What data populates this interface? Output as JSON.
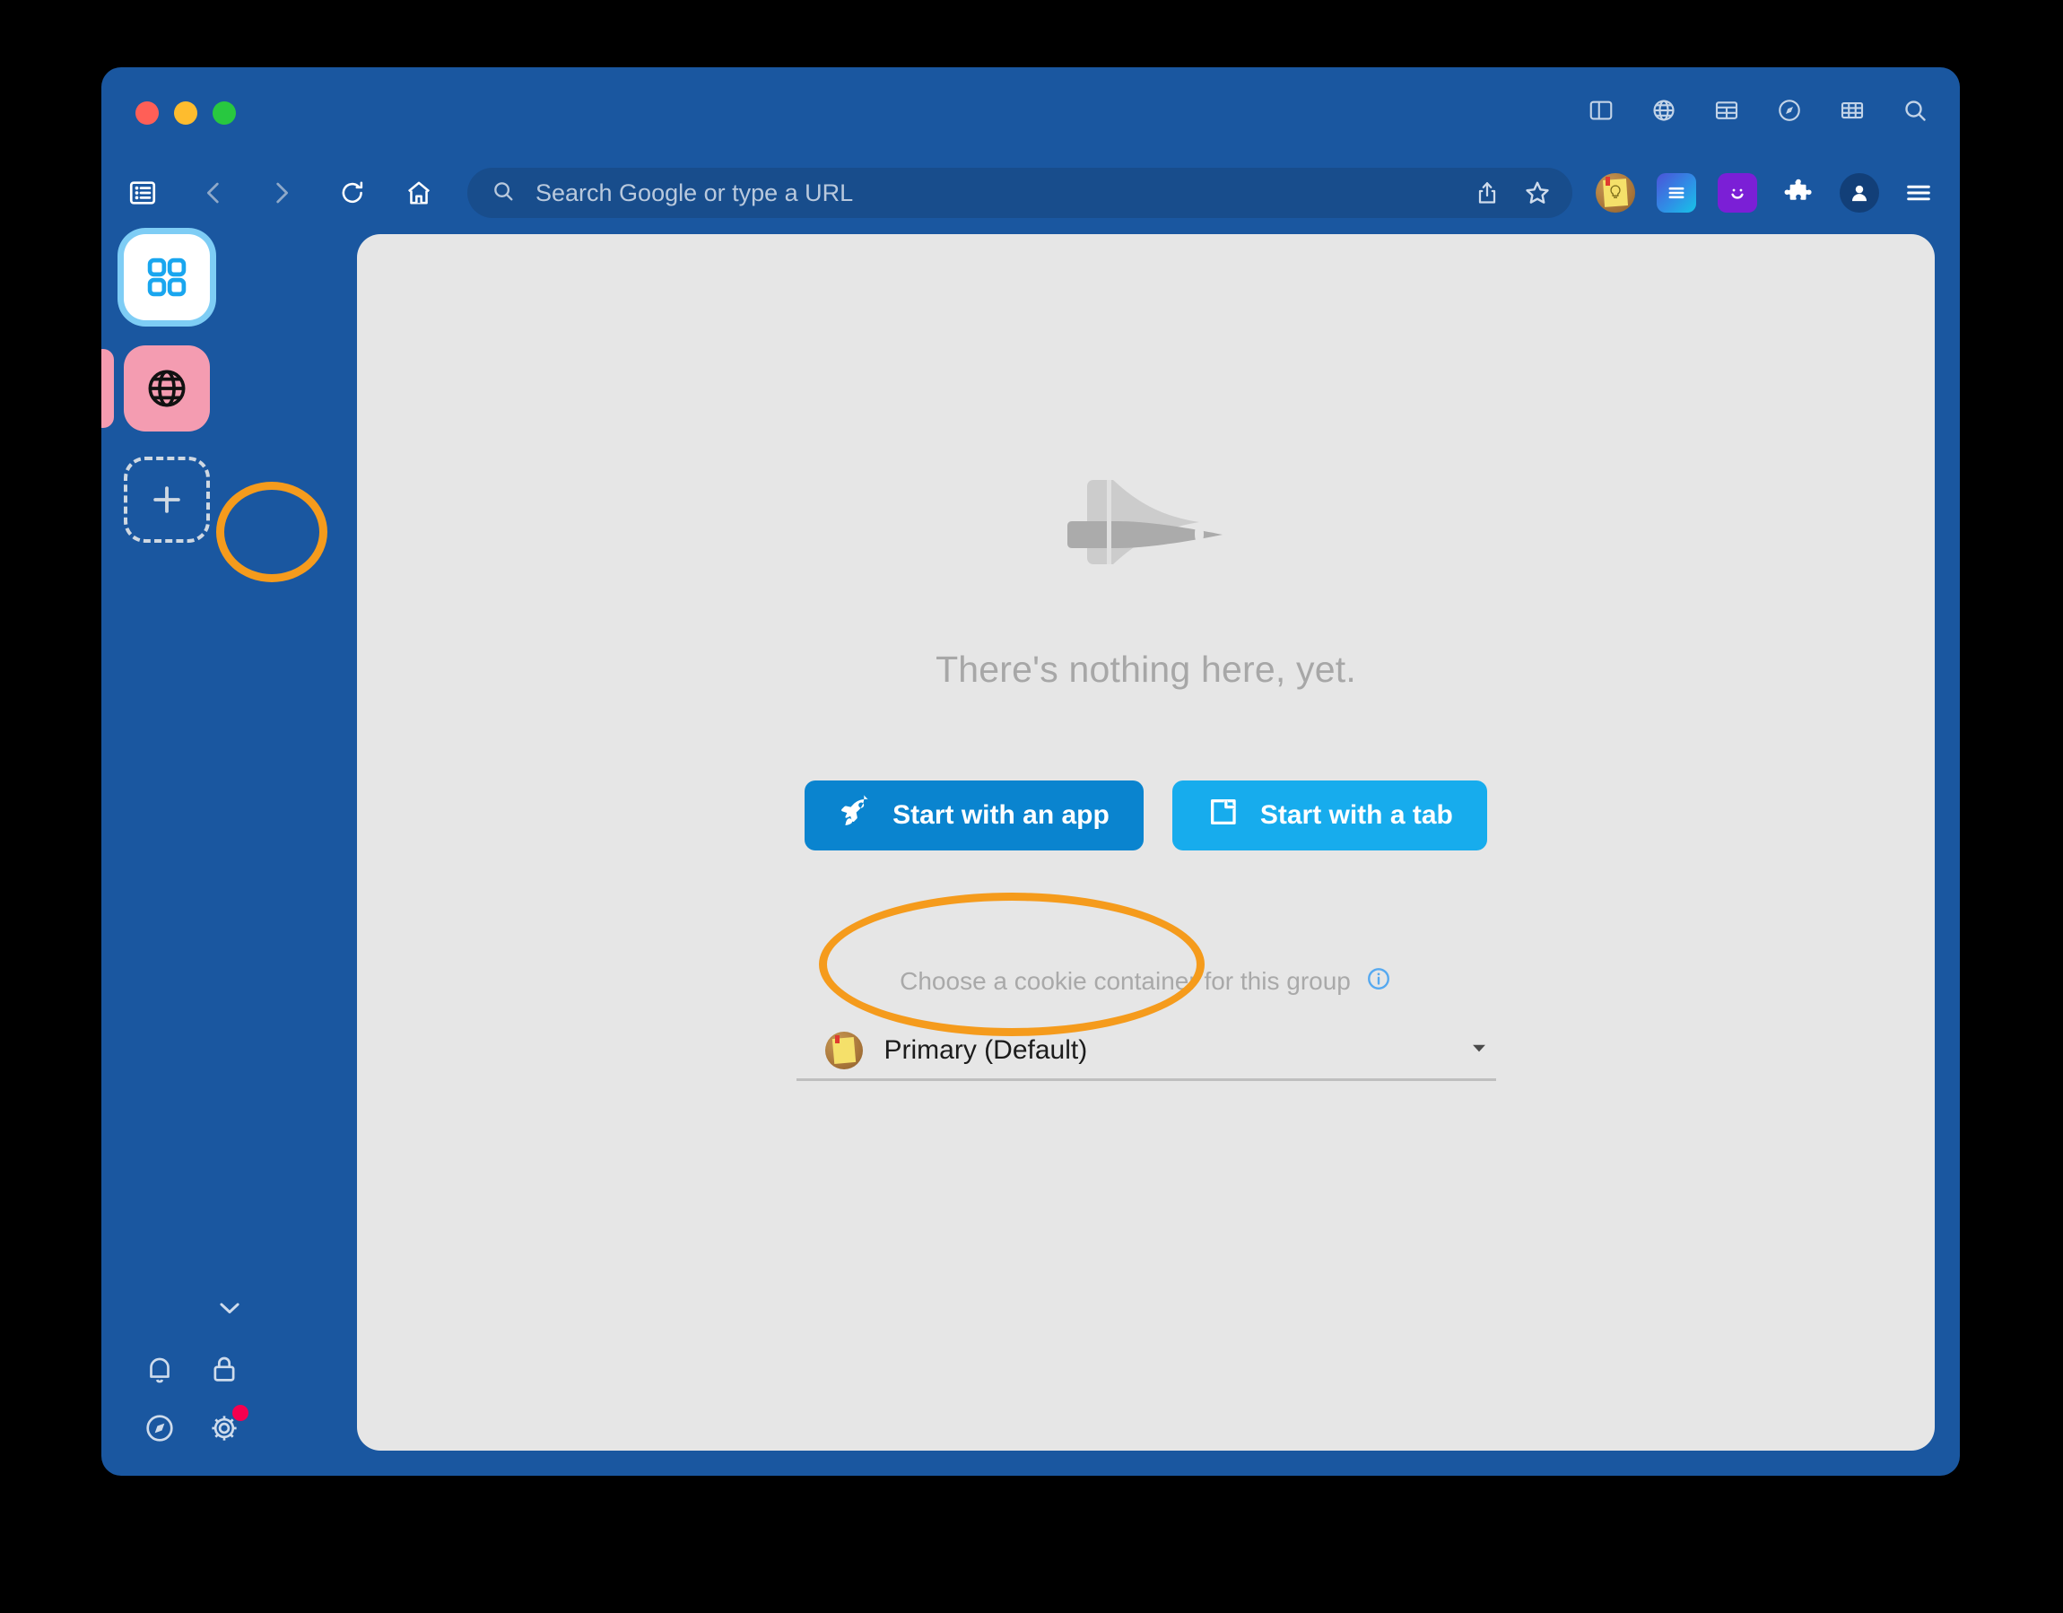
{
  "window": {
    "traffic_lights": [
      "close",
      "minimize",
      "maximize"
    ],
    "chrome_color": "#1a57a0",
    "content_bg": "#e6e6e6",
    "annotation_color": "#f59b1c"
  },
  "window_tools": [
    {
      "name": "split-view-icon",
      "label": "Split View"
    },
    {
      "name": "globe-icon",
      "label": "Web"
    },
    {
      "name": "table-icon",
      "label": "Table"
    },
    {
      "name": "compass-icon",
      "label": "Explore"
    },
    {
      "name": "grid-icon",
      "label": "Grid"
    },
    {
      "name": "search-icon",
      "label": "Search"
    }
  ],
  "toolbar": {
    "sidebar_toggle": "Toggle sidebar",
    "back": "Back",
    "forward": "Forward",
    "reload": "Reload",
    "home": "Home",
    "omnibox_placeholder": "Search Google or type a URL",
    "omnibox_value": "",
    "share": "Share",
    "bookmark": "Bookmark",
    "extensions": [
      {
        "name": "notes-extension-icon",
        "label": "Notes"
      },
      {
        "name": "reader-extension-icon",
        "label": "Reader"
      },
      {
        "name": "smiley-extension-icon",
        "label": "Smiley"
      },
      {
        "name": "puzzle-extension-icon",
        "label": "Extensions"
      },
      {
        "name": "profile-avatar-icon",
        "label": "Profile"
      },
      {
        "name": "menu-icon",
        "label": "Menu"
      }
    ]
  },
  "sidebar": {
    "tabs": [
      {
        "name": "apps-group",
        "label": "Apps",
        "active": true,
        "color": "#ffffff"
      },
      {
        "name": "web-group",
        "label": "Web",
        "active": false,
        "color": "#f49cb1"
      },
      {
        "name": "new-group",
        "label": "New group",
        "active": false,
        "color": ""
      }
    ],
    "peek_tab_color": "#f49cb1",
    "collapse": "Collapse",
    "bottom_icons": [
      {
        "name": "bell-icon",
        "label": "Notifications",
        "badge": false
      },
      {
        "name": "lock-icon",
        "label": "Privacy",
        "badge": false
      },
      {
        "name": "compass-icon",
        "label": "Discover",
        "badge": false
      },
      {
        "name": "gear-icon",
        "label": "Settings",
        "badge": true
      }
    ],
    "badge_color": "#f5004f"
  },
  "main": {
    "illustration": "space-shuttle-illustration",
    "empty_title": "There's nothing here, yet.",
    "buttons": [
      {
        "name": "start-with-app-button",
        "label": "Start with an app",
        "icon": "rocket-icon",
        "color": "#0a84cf",
        "highlighted": true
      },
      {
        "name": "start-with-tab-button",
        "label": "Start with a tab",
        "icon": "new-tab-icon",
        "color": "#17aced",
        "highlighted": false
      }
    ],
    "cookie": {
      "label": "Choose a cookie container for this group",
      "info_icon": "info-icon",
      "selected": "Primary (Default)",
      "avatar": "notes-avatar-icon",
      "chevron": "chevron-down-icon"
    }
  },
  "annotations": [
    {
      "name": "annotation-new-group",
      "target": "new-group-button",
      "shape": "ellipse"
    },
    {
      "name": "annotation-start-with-app",
      "target": "start-with-app-button",
      "shape": "ellipse"
    }
  ]
}
